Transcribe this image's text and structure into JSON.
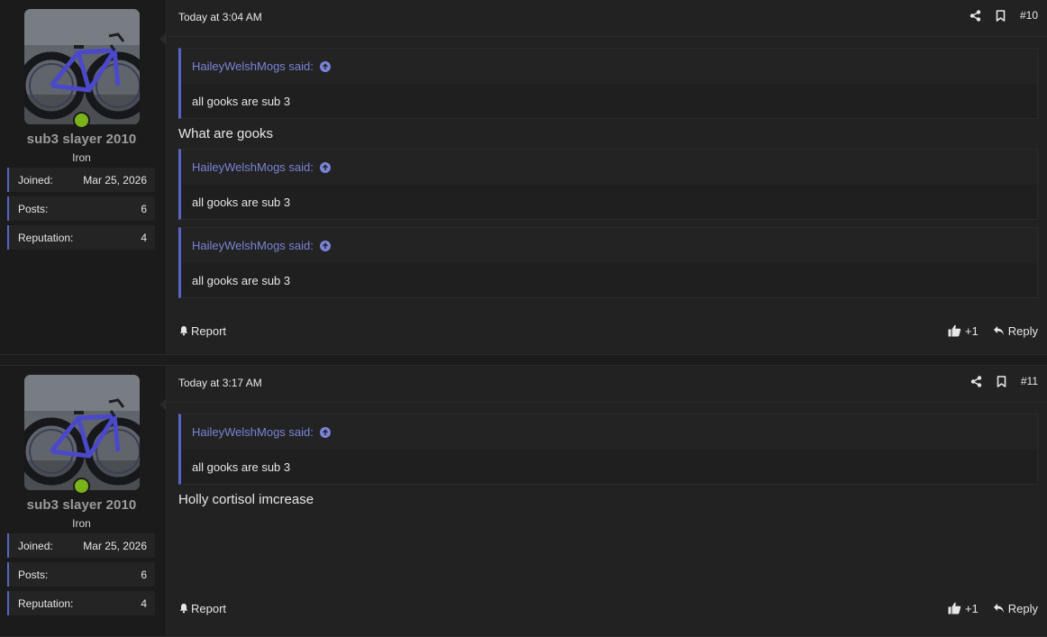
{
  "posts": [
    {
      "user": {
        "name": "sub3 slayer 2010",
        "title": "Iron",
        "stats": [
          {
            "label": "Joined:",
            "value": "Mar 25, 2026"
          },
          {
            "label": "Posts:",
            "value": "6"
          },
          {
            "label": "Reputation:",
            "value": "4"
          }
        ]
      },
      "timestamp": "Today at 3:04 AM",
      "number": "#10",
      "quotes_before": [
        {
          "author": "HaileyWelshMogs said:",
          "text": "all gooks are sub 3"
        }
      ],
      "text": "What are gooks",
      "quotes_after": [
        {
          "author": "HaileyWelshMogs said:",
          "text": "all gooks are sub 3"
        },
        {
          "author": "HaileyWelshMogs said:",
          "text": "all gooks are sub 3"
        }
      ],
      "actions": {
        "report": "Report",
        "like": "+1",
        "reply": "Reply"
      }
    },
    {
      "user": {
        "name": "sub3 slayer 2010",
        "title": "Iron",
        "stats": [
          {
            "label": "Joined:",
            "value": "Mar 25, 2026"
          },
          {
            "label": "Posts:",
            "value": "6"
          },
          {
            "label": "Reputation:",
            "value": "4"
          }
        ]
      },
      "timestamp": "Today at 3:17 AM",
      "number": "#11",
      "quotes_before": [
        {
          "author": "HaileyWelshMogs said:",
          "text": "all gooks are sub 3"
        }
      ],
      "text": "Holly cortisol imcrease",
      "quotes_after": [],
      "actions": {
        "report": "Report",
        "like": "+1",
        "reply": "Reply"
      }
    }
  ],
  "icons": {
    "share": "share-icon",
    "bookmark": "bookmark-icon",
    "up": "arrow-up-circle-icon",
    "bell": "bell-icon",
    "like": "thumbs-up-icon",
    "reply": "reply-icon"
  },
  "colors": {
    "accent": "#5865c4",
    "quote_author": "#7a83d6",
    "online": "#7bb31a"
  }
}
